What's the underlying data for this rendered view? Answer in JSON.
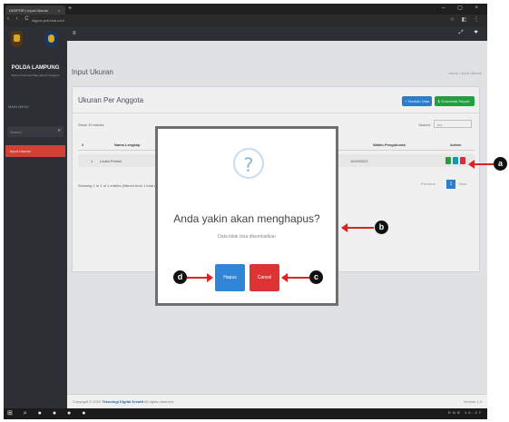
{
  "browser": {
    "tab_title": "DIGIPOR | Input Ukuran",
    "tab_close": "×",
    "new_tab": "+",
    "url": "digipor.polresta.com",
    "nav": "‹ › C",
    "window_controls": "– ▢ ×",
    "addr_icons": "☆ ◧ ⋮"
  },
  "sidebar": {
    "brand": "POLDA LAMPUNG",
    "brand_sub": "Sistem Informasi Data Ukuran Seragam",
    "menu_head": "MAIN MENU",
    "search_placeholder": "Search",
    "search_icon": "search-icon",
    "active_item": "Input Ukuran"
  },
  "header": {
    "menu_icon": "hamburger-icon",
    "right_icons": "expand-icon user-icon"
  },
  "page": {
    "title": "Input Ukuran",
    "breadcrumb": "Home / Input Ukuran"
  },
  "card": {
    "title": "Ukuran Per Anggota",
    "btn_add": "+ Tambah Data",
    "btn_download": "⬇ Download Report",
    "show_entries": "Show 10 entries",
    "search_label": "Search:",
    "search_value": "tes",
    "columns": [
      "#",
      "Nama Lengkap",
      "Waktu Pengukuran",
      "Action"
    ],
    "rows": [
      {
        "no": "1",
        "name": "Lavita Pertiwi",
        "time": "11/09/2022"
      }
    ],
    "showing": "Showing 1 to 1 of 1 entries (filtered from 1 total entries)",
    "pager": {
      "prev": "Previous",
      "page": "1",
      "next": "Next"
    }
  },
  "footer": {
    "copyright_prefix": "Copyright © 2022",
    "copyright_brand": "Teknologi Digital Kreatif",
    "copyright_suffix": "All rights reserved.",
    "version": "Version 1.0"
  },
  "taskbar": {
    "tray": "ENG 10:27"
  },
  "modal": {
    "icon": "?",
    "title": "Anda yakin akan menghapus?",
    "text": "Data tidak bisa dikembalikan",
    "confirm_label": "Hapus",
    "cancel_label": "Cancel"
  },
  "annotations": {
    "a": "a",
    "b": "b",
    "c": "c",
    "d": "d"
  },
  "colors": {
    "confirm": "#3085d6",
    "cancel": "#dd3333",
    "sidebar_active": "#e0443a",
    "arrow": "#dd2222"
  }
}
